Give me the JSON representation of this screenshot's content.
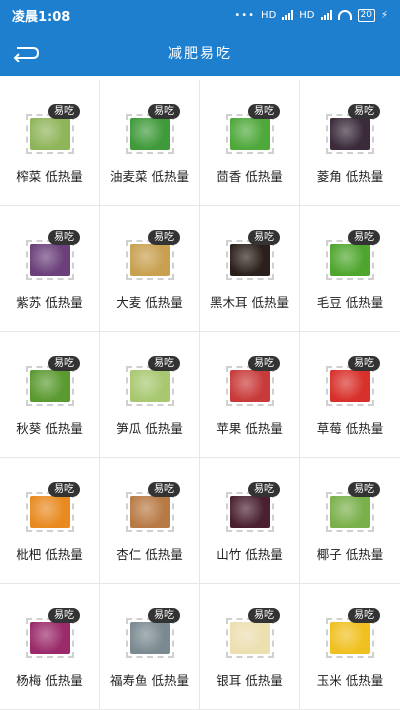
{
  "status": {
    "time": "凌晨1:08",
    "network1": "HD",
    "network2": "HD",
    "battery": "20"
  },
  "app": {
    "title": "减肥易吃"
  },
  "colors": {
    "accent": "#1f7fcf",
    "badge": "#333333"
  },
  "foods": [
    {
      "name": "榨菜 低热量",
      "badge": "易吃",
      "color": "#8fb55a"
    },
    {
      "name": "油麦菜 低热量",
      "badge": "易吃",
      "color": "#3f9a3a"
    },
    {
      "name": "茴香 低热量",
      "badge": "易吃",
      "color": "#4ea83a"
    },
    {
      "name": "菱角 低热量",
      "badge": "易吃",
      "color": "#3a2a3a"
    },
    {
      "name": "紫苏 低热量",
      "badge": "易吃",
      "color": "#6a3f7a"
    },
    {
      "name": "大麦 低热量",
      "badge": "易吃",
      "color": "#c8a050"
    },
    {
      "name": "黑木耳 低热量",
      "badge": "易吃",
      "color": "#2a1f1a"
    },
    {
      "name": "毛豆 低热量",
      "badge": "易吃",
      "color": "#4fa62e"
    },
    {
      "name": "秋葵 低热量",
      "badge": "易吃",
      "color": "#5a9a30"
    },
    {
      "name": "笋瓜 低热量",
      "badge": "易吃",
      "color": "#a8c870"
    },
    {
      "name": "苹果 低热量",
      "badge": "易吃",
      "color": "#c93a3a"
    },
    {
      "name": "草莓 低热量",
      "badge": "易吃",
      "color": "#d8302a"
    },
    {
      "name": "枇杷 低热量",
      "badge": "易吃",
      "color": "#e88a20"
    },
    {
      "name": "杏仁 低热量",
      "badge": "易吃",
      "color": "#b87a45"
    },
    {
      "name": "山竹 低热量",
      "badge": "易吃",
      "color": "#4a2030"
    },
    {
      "name": "椰子 低热量",
      "badge": "易吃",
      "color": "#7ab04a"
    },
    {
      "name": "杨梅 低热量",
      "badge": "易吃",
      "color": "#9a2a6a"
    },
    {
      "name": "福寿鱼 低热量",
      "badge": "易吃",
      "color": "#7a8a90"
    },
    {
      "name": "银耳 低热量",
      "badge": "易吃",
      "color": "#ecdfb0"
    },
    {
      "name": "玉米 低热量",
      "badge": "易吃",
      "color": "#f0c020"
    }
  ]
}
